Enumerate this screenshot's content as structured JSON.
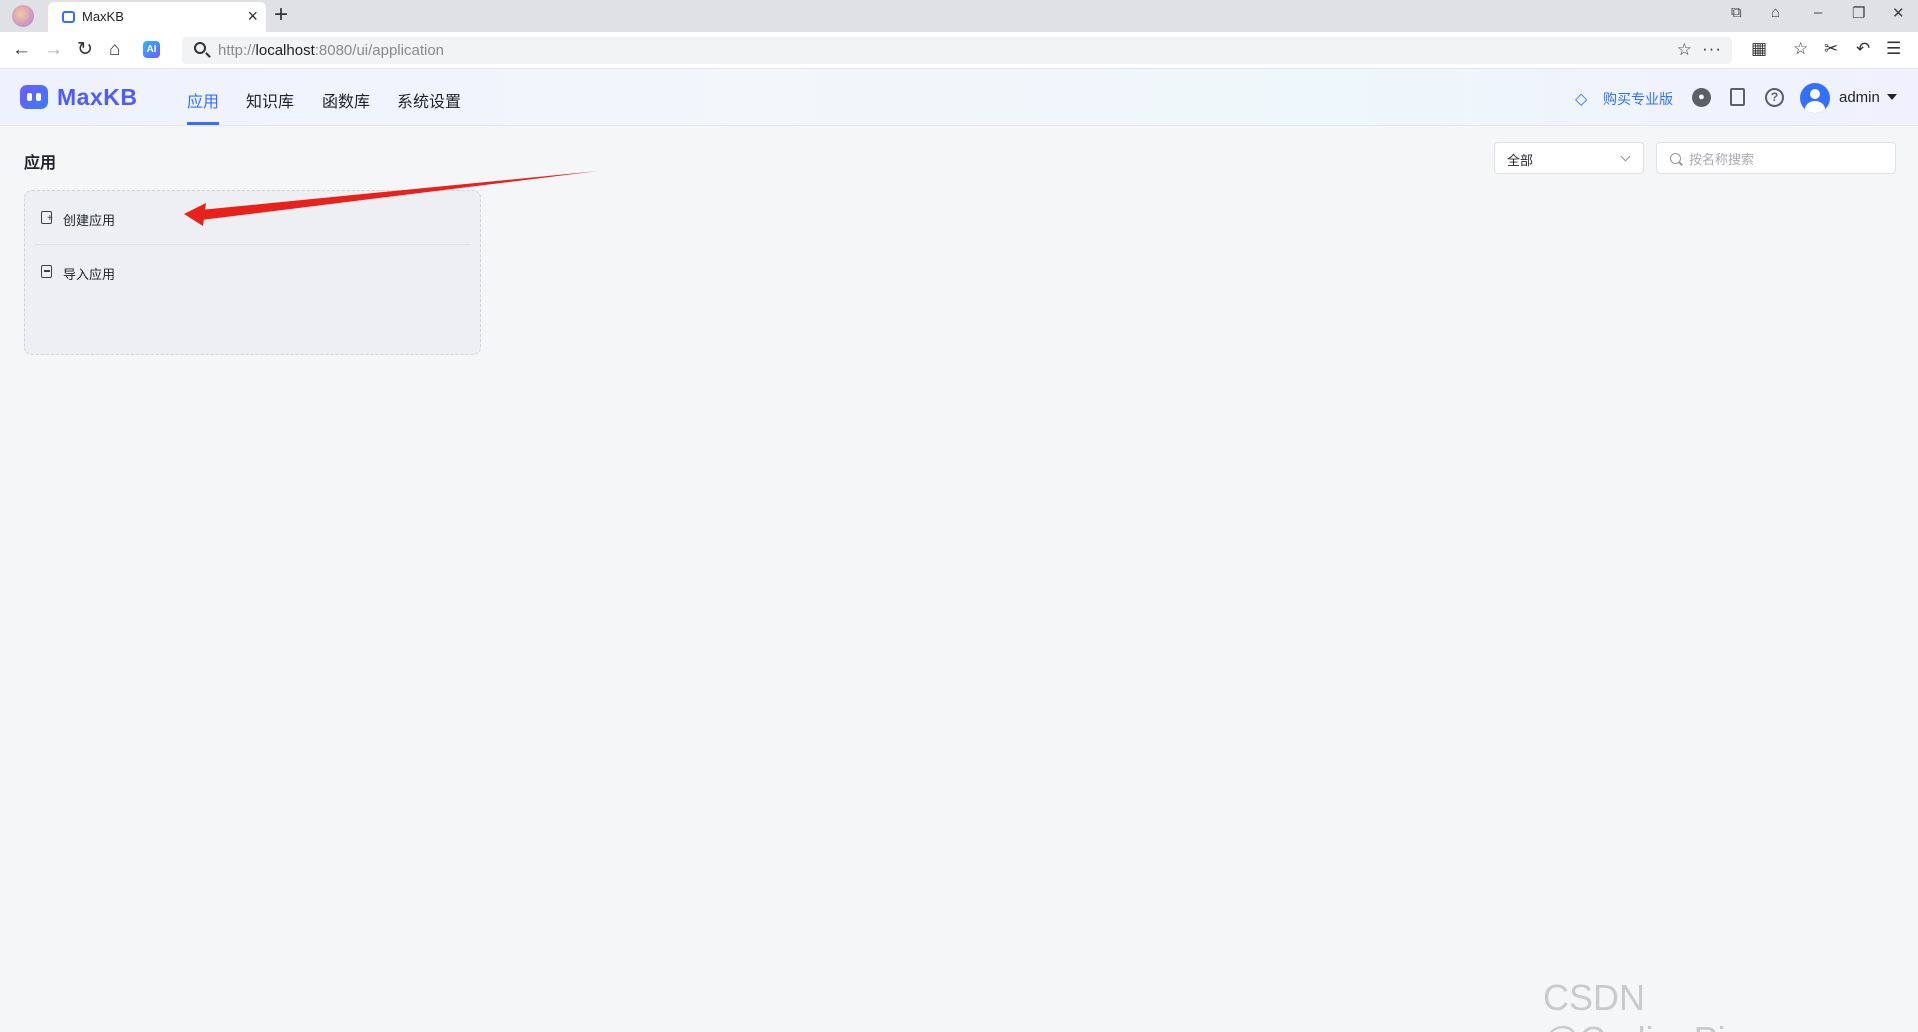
{
  "browser": {
    "tab_title": "MaxKB",
    "url_prefix": "http://",
    "url_host": "localhost",
    "url_rest": ":8080/ui/application"
  },
  "header": {
    "logo": "MaxKB",
    "nav": [
      "应用",
      "知识库",
      "函数库",
      "系统设置"
    ],
    "active_nav": "应用",
    "pro_label": "购买专业版",
    "user": "admin",
    "accent_color": "#3370ff"
  },
  "main": {
    "title": "应用",
    "filter_value": "全部",
    "search_placeholder": "按名称搜索",
    "card": {
      "create_label": "创建应用",
      "import_label": "导入应用"
    }
  },
  "watermark": "CSDN @CodingPioneer"
}
